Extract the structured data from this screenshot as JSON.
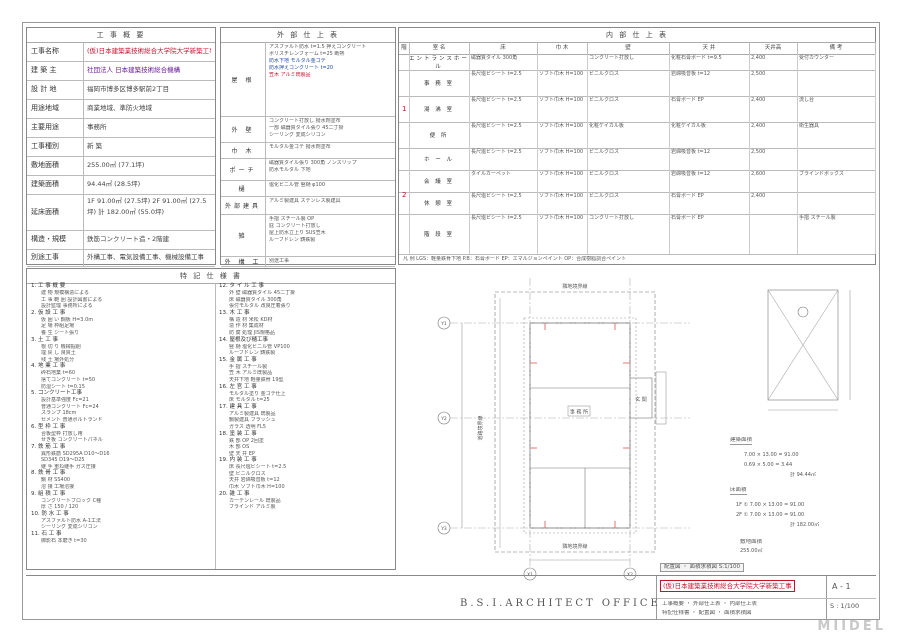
{
  "overview": {
    "title": "工 事 概 要",
    "rows": [
      {
        "label": "工事名称",
        "value": "(仮)日本建築業技術総合大学院大学新築工事"
      },
      {
        "label": "建 築 主",
        "value": "社団法人 日本建築技術総合機構"
      },
      {
        "label": "設 計 地",
        "value": "福岡市博多区博多駅前2丁目"
      },
      {
        "label": "用途地域",
        "value": "商業地域、準防火地域"
      },
      {
        "label": "主要用途",
        "value": "事務所"
      },
      {
        "label": "工事種別",
        "value": "新 築"
      },
      {
        "label": "敷地面積",
        "value": "255.00㎡ (77.1坪)"
      },
      {
        "label": "建築面積",
        "value": "94.44㎡ (28.5坪)"
      },
      {
        "label": "延床面積",
        "value": "1F 91.00㎡ (27.5坪)   2F 91.00㎡ (27.5坪)   計 182.00㎡ (55.0坪)"
      },
      {
        "label": "構造・規模",
        "value": "鉄筋コンクリート造・2階建"
      },
      {
        "label": "別途工事",
        "value": "外構工事、電気設備工事、機械設備工事"
      }
    ]
  },
  "exterior": {
    "title": "外 部 仕 上 表",
    "rows": [
      {
        "label": "屋 根",
        "lines": [
          "アスファルト防水 t=1.5 押えコンクリート",
          "ポリスチレンフォーム t=25 断熱",
          "防水下地 モルタル金ゴテ",
          "防水押えコンクリート t=20"
        ],
        "note": "笠木 アルミ既製品"
      },
      {
        "label": "外 壁",
        "lines": [
          "コンクリート打放し 撥水剤塗布",
          "一部 磁器質タイル張り 45二丁掛",
          "シーリング 変成シリコン"
        ]
      },
      {
        "label": "巾 木",
        "lines": [
          "モルタル金ゴテ 撥水剤塗布"
        ]
      },
      {
        "label": "ポーチ",
        "lines": [
          "磁器質タイル張り 300角 ノンスリップ",
          "防水モルタル 下地"
        ]
      },
      {
        "label": "樋",
        "lines": [
          "塩化ビニル管 竪樋 φ100"
        ]
      },
      {
        "label": "外部建具",
        "lines": [
          "アルミ製建具 ステンレス製建具"
        ]
      },
      {
        "label": "雑",
        "lines": [
          "手摺 スチール製 OP",
          "庇 コンクリート打放し",
          "屋上防水立上り SUS笠木",
          "ルーフドレン 鋳鉄製"
        ]
      },
      {
        "label": "外 構 工",
        "lines": [
          "別途工事"
        ]
      }
    ]
  },
  "interior": {
    "title": "内 部 仕 上 表",
    "headers": [
      "階",
      "室 名",
      "床",
      "巾 木",
      "壁",
      "天 井",
      "天井高",
      "備 考"
    ],
    "floor_labels": [
      "1",
      "2"
    ],
    "rows": [
      {
        "room": "エントランスホール",
        "floor": "磁器質タイル 300角",
        "base": "",
        "wall": "コンクリート打放し",
        "ceiling": "化粧石膏ボード t=9.5",
        "height": "2,400",
        "note": "受付カウンター"
      },
      {
        "room": "事 務 室",
        "floor": "長尺塩ビシート t=2.5",
        "base": "ソフト巾木 H=100",
        "wall": "ビニルクロス",
        "ceiling": "岩綿吸音板 t=12",
        "height": "2,500",
        "note": ""
      },
      {
        "room": "湯 沸 室",
        "floor": "長尺塩ビシート t=2.5",
        "base": "ソフト巾木 H=100",
        "wall": "ビニルクロス",
        "ceiling": "石膏ボード EP",
        "height": "2,400",
        "note": "流し台"
      },
      {
        "room": "便 所",
        "floor": "長尺塩ビシート t=2.5",
        "base": "ソフト巾木 H=100",
        "wall": "化粧ケイカル板",
        "ceiling": "化粧ケイカル板",
        "height": "2,400",
        "note": "衛生器具"
      },
      {
        "room": "ホ ー ル",
        "floor": "長尺塩ビシート t=2.5",
        "base": "ソフト巾木 H=100",
        "wall": "ビニルクロス",
        "ceiling": "岩綿吸音板 t=12",
        "height": "2,500",
        "note": ""
      },
      {
        "room": "会 議 室",
        "floor": "タイルカーペット",
        "base": "ソフト巾木 H=100",
        "wall": "ビニルクロス",
        "ceiling": "岩綿吸音板 t=12",
        "height": "2,600",
        "note": "ブラインドボックス"
      },
      {
        "room": "休 憩 室",
        "floor": "長尺塩ビシート t=2.5",
        "base": "ソフト巾木 H=100",
        "wall": "ビニルクロス",
        "ceiling": "石膏ボード EP",
        "height": "2,400",
        "note": ""
      },
      {
        "room": "階 段 室",
        "floor": "長尺塩ビシート t=2.5",
        "base": "ソフト巾木 H=100",
        "wall": "コンクリート打放し",
        "ceiling": "石膏ボード EP",
        "height": "",
        "note": "手摺 スチール製"
      }
    ],
    "legend": "凡 例   LGS：軽量鉄骨下地   P.B：石膏ボード   EP：エマルジョンペイント   OP：合成樹脂調合ペイント"
  },
  "specs": {
    "title": "特 記 仕 様 書",
    "col1": [
      {
        "h": "1. 工 事 概 要",
        "l": [
          "建 物 規模構造による",
          "工 事 範 囲 設計図書による",
          "設計監理 事務所による"
        ]
      },
      {
        "h": "2. 仮 設 工 事",
        "l": [
          "仮 囲 い 鋼板 H=3.0m",
          "足 場 枠組足場",
          "養 生 シート張り"
        ]
      },
      {
        "h": "3. 土 工 事",
        "l": [
          "根 切 り 機械掘削",
          "埋 戻 し 良質土",
          "残 土 場外処分"
        ]
      },
      {
        "h": "4. 地 業 工 事",
        "l": [
          "砕石地業 t=60",
          "捨てコンクリート t=50",
          "防湿シート t=0.15"
        ]
      },
      {
        "h": "5. コンクリート工事",
        "l": [
          "設計基準強度 Fc=21",
          "普通コンクリート Fc=24",
          "スランプ 18cm",
          "セメント 普通ポルトランド"
        ]
      },
      {
        "h": "6. 型 枠 工 事",
        "l": [
          "合板型枠 打放し用",
          "せき板 コンクリートパネル"
        ]
      },
      {
        "h": "7. 鉄 筋 工 事",
        "l": [
          "異形鉄筋 SD295A D10〜D16",
          "SD345 D19〜D25",
          "継 手 重ね継手 ガス圧接"
        ]
      },
      {
        "h": "8. 鉄 骨 工 事",
        "l": [
          "鋼 材 SS400",
          "溶 接 工場溶接"
        ]
      },
      {
        "h": "9. 組 積 工 事",
        "l": [
          "コンクリートブロック C種",
          "厚 さ 150 / 120"
        ]
      },
      {
        "h": "10. 防 水 工 事",
        "l": [
          "アスファルト防水 A-1工法",
          "シーリング 変成シリコン"
        ]
      },
      {
        "h": "11. 石 工 事",
        "l": [
          "御影石 本磨き t=30"
        ]
      }
    ],
    "col2": [
      {
        "h": "12. タ イ ル 工 事",
        "l": [
          "外 壁 磁器質タイル 45二丁掛",
          "床 磁器質タイル 300角",
          "張付モルタル 改良圧着張り"
        ]
      },
      {
        "h": "13. 木 工 事",
        "l": [
          "構 造 材 米松 KD材",
          "造 作 材 集成材",
          "防 腐 処理 JIS規格品"
        ]
      },
      {
        "h": "14. 屋根及び樋工事",
        "l": [
          "竪 樋 塩化ビニル管 VP100",
          "ルーフドレン 鋳鉄製"
        ]
      },
      {
        "h": "15. 金 属 工 事",
        "l": [
          "手 摺 スチール製",
          "笠 木 アルミ既製品",
          "天井下地 軽量鉄骨 19型"
        ]
      },
      {
        "h": "16. 左 官 工 事",
        "l": [
          "モルタル塗り 金ゴテ仕上",
          "床 モルタル t=25"
        ]
      },
      {
        "h": "17. 建 具 工 事",
        "l": [
          "アルミ製建具 既製品",
          "鋼製建具 フラッシュ",
          "ガラス 透明 FL5"
        ]
      },
      {
        "h": "18. 塗 装 工 事",
        "l": [
          "鉄 部 OP 2回塗",
          "木 部 OS",
          "壁 天 井 EP"
        ]
      },
      {
        "h": "19. 内 装 工 事",
        "l": [
          "床 長尺塩ビシート t=2.5",
          "壁 ビニルクロス",
          "天井 岩綿吸音板 t=12",
          "巾木 ソフト巾木 H=100"
        ]
      },
      {
        "h": "20. 雑 工 事",
        "l": [
          "カーテンレール 既製品",
          "ブラインド アルミ製"
        ]
      }
    ]
  },
  "plan": {
    "grid_x": [
      "X1",
      "X2"
    ],
    "grid_y": [
      "Y1",
      "Y2",
      "Y3"
    ],
    "road_top": "隣地境界線",
    "road_bottom": "隣地境界線",
    "road_left": "道路境界線",
    "room_label": "事 務 所",
    "entry_label": "玄 関",
    "caption": "配置図 ・ 面積求積図  S:1/100"
  },
  "area_calc": {
    "title1": "建築面積",
    "rows1": [
      "7.00 × 13.00 = 91.00",
      "0.69 × 5.00 = 3.44",
      "計 94.44㎡"
    ],
    "title2": "床面積",
    "rows2": [
      "1F ① 7.00 × 13.00 = 91.00",
      "2F ① 7.00 × 13.00 = 91.00",
      "計 182.00㎡"
    ],
    "site_title": "敷地面積",
    "site_value": "255.00㎡"
  },
  "titleblock": {
    "office": "B.S.I.ARCHITECT OFFICE",
    "project": "(仮)日本建築業技術総合大学院大学新築工事",
    "drawing_name": "工事概要 ・ 外部仕上表 ・ 内部仕上表",
    "drawing_name2": "特記仕様書 ・ 配置図 ・ 面積求積図",
    "sheet_no": "A - 1",
    "scale": "S : 1/100",
    "watermark": "MIIDEL"
  }
}
